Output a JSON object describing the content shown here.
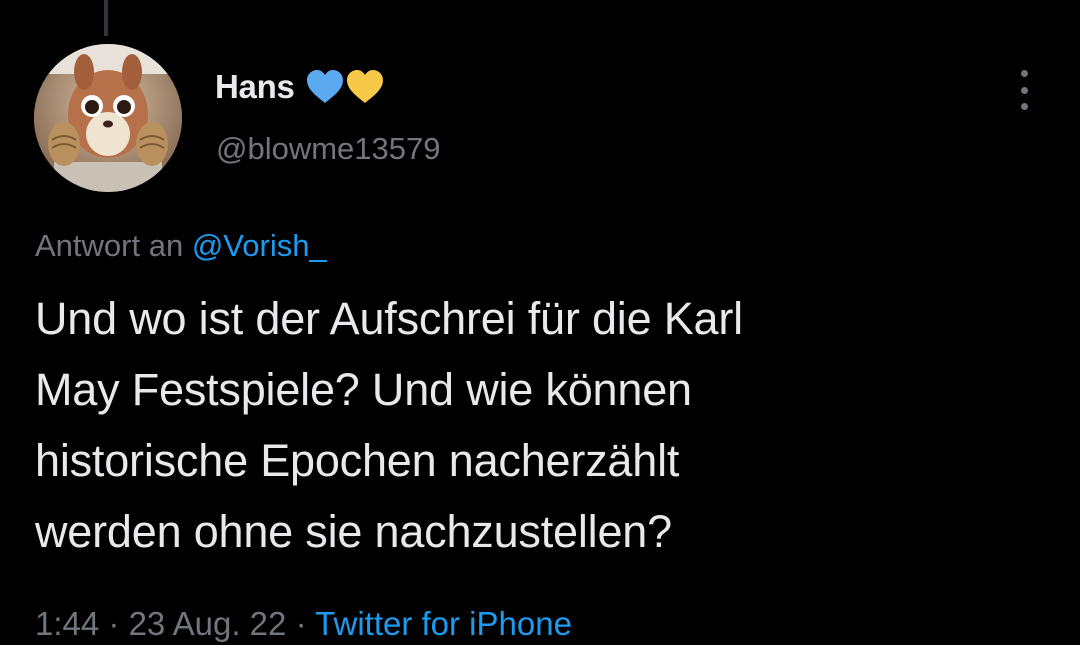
{
  "tweet": {
    "author": {
      "display_name": "Hans",
      "badges": [
        "blue-heart-icon",
        "yellow-heart-icon"
      ],
      "handle": "@blowme13579",
      "avatar": "squirrel-avatar"
    },
    "reply_prefix": "Antwort an",
    "reply_to": "@Vorish_",
    "text_lines": [
      "Und wo ist der Aufschrei für die Karl",
      "May Festspiele? Und wie können",
      "historische Epochen nacherzählt",
      "werden ohne sie nachzustellen?"
    ],
    "time": "1:44",
    "separator": "·",
    "date": "23 Aug. 22",
    "source": "Twitter for iPhone",
    "menu_icon": "more-vertical-icon"
  },
  "colors": {
    "background": "#000000",
    "text": "#e7e9ea",
    "secondary": "#71767b",
    "link": "#1d9bf0",
    "blue_heart": "#5ba9f0",
    "yellow_heart": "#f7c948"
  }
}
